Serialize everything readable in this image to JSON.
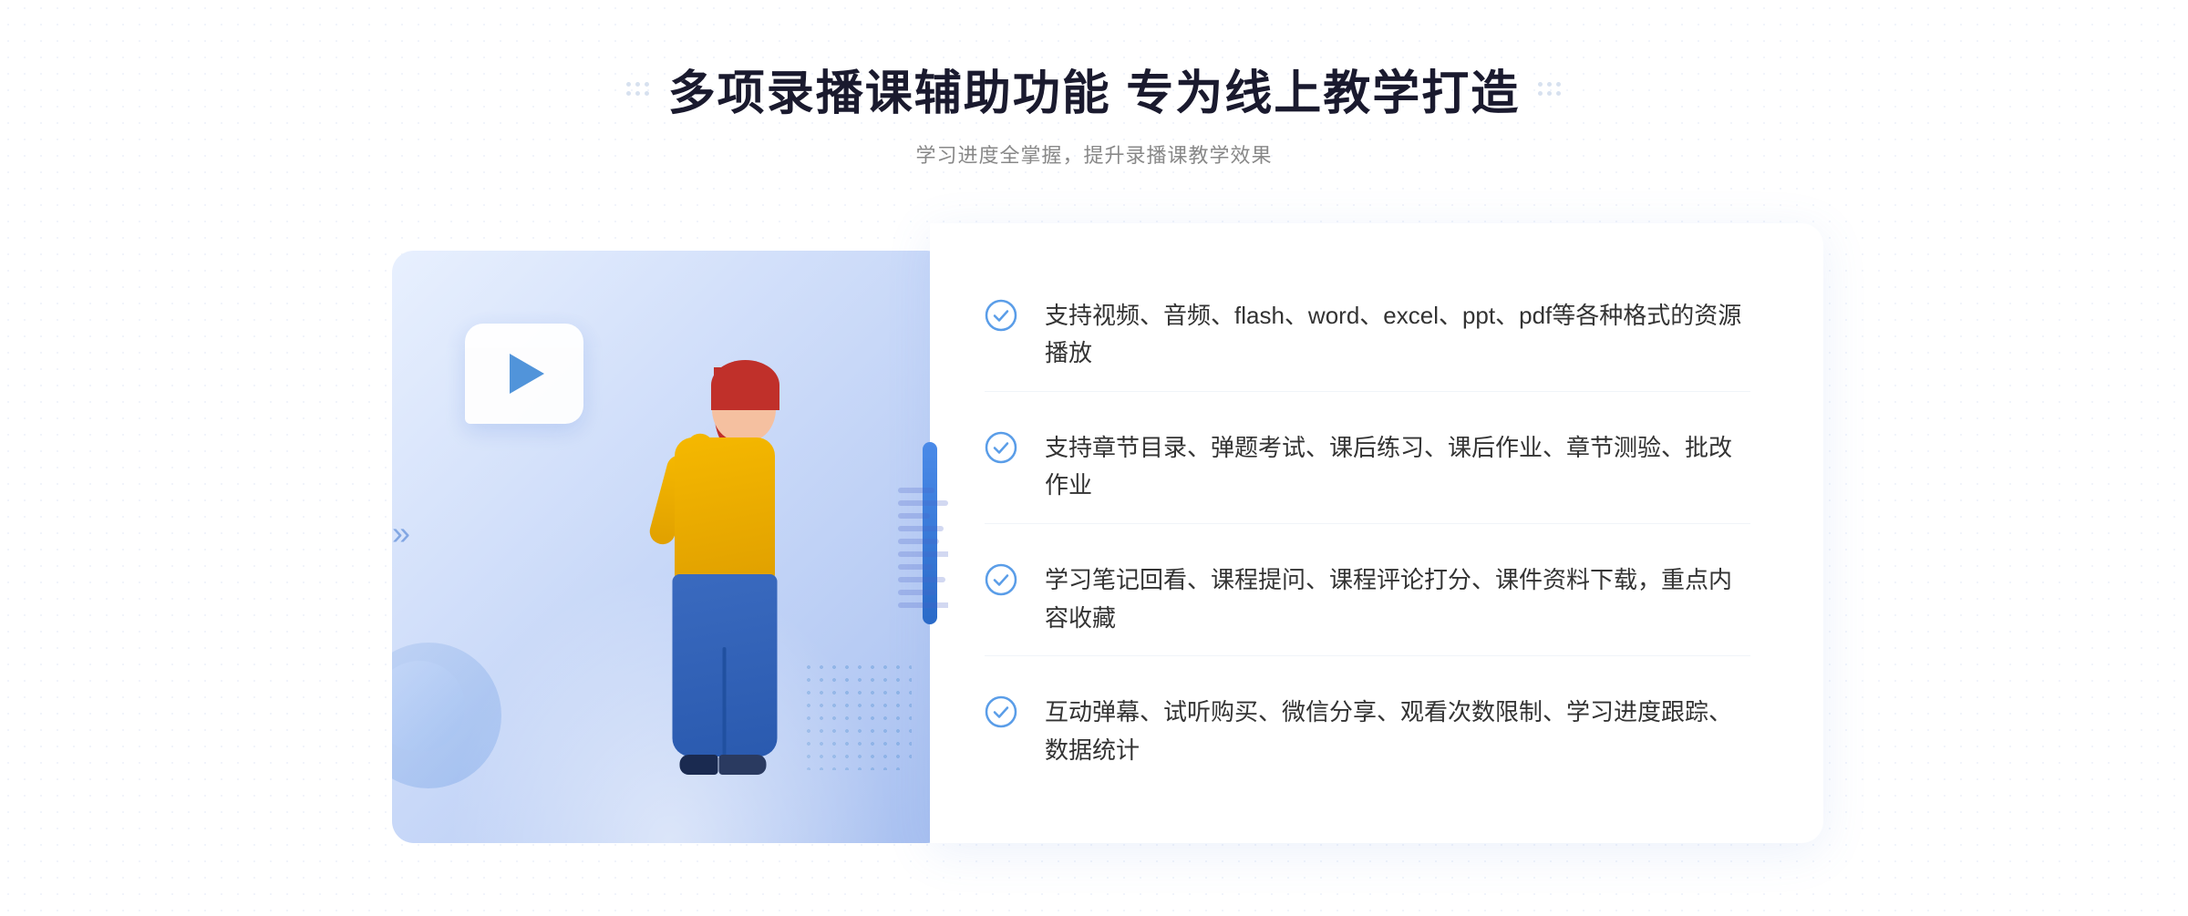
{
  "page": {
    "background_color": "#ffffff"
  },
  "header": {
    "title": "多项录播课辅助功能 专为线上教学打造",
    "subtitle": "学习进度全掌握，提升录播课教学效果",
    "deco_left": "⁞⁞",
    "deco_right": "⁞⁞"
  },
  "features": [
    {
      "id": 1,
      "text": "支持视频、音频、flash、word、excel、ppt、pdf等各种格式的资源播放"
    },
    {
      "id": 2,
      "text": "支持章节目录、弹题考试、课后练习、课后作业、章节测验、批改作业"
    },
    {
      "id": 3,
      "text": "学习笔记回看、课程提问、课程评论打分、课件资料下载，重点内容收藏"
    },
    {
      "id": 4,
      "text": "互动弹幕、试听购买、微信分享、观看次数限制、学习进度跟踪、数据统计"
    }
  ],
  "colors": {
    "primary_blue": "#4a8ae8",
    "check_color": "#5a9de8",
    "title_color": "#1a1a2e",
    "text_color": "#333333",
    "subtitle_color": "#888888"
  },
  "icons": {
    "check_circle": "check-circle",
    "play": "play-icon",
    "chevron_left": "chevron-left-icon"
  }
}
